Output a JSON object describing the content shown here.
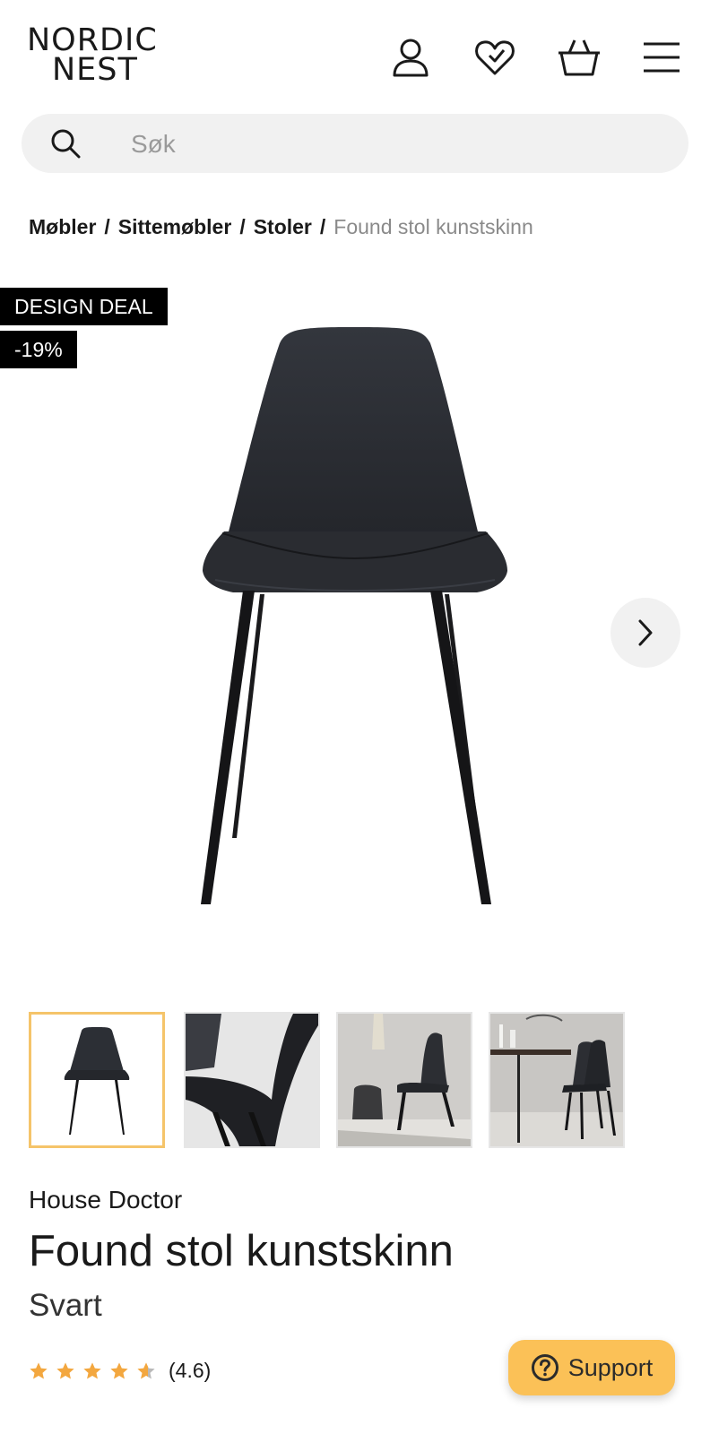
{
  "header": {
    "logo_line1": "NORDIC",
    "logo_line2": "NEST",
    "icons": [
      "user-icon",
      "heart-icon",
      "basket-icon",
      "menu-icon"
    ]
  },
  "search": {
    "placeholder": "Søk",
    "value": ""
  },
  "breadcrumb": {
    "items": [
      "Møbler",
      "Sittemøbler",
      "Stoler"
    ],
    "separator": "/",
    "current": "Found stol kunstskinn"
  },
  "badges": {
    "deal": "DESIGN DEAL",
    "discount": "-19%"
  },
  "gallery": {
    "thumbnails": 4,
    "selected_index": 0
  },
  "product": {
    "brand": "House Doctor",
    "name": "Found stol kunstskinn",
    "variant": "Svart",
    "rating_value": 4.6,
    "rating_label": "(4.6)"
  },
  "support": {
    "label": "Support"
  },
  "colors": {
    "accent": "#fbc157",
    "selected_border": "#f5c46a",
    "badge_bg": "#000000",
    "search_bg": "#f1f1f1",
    "star": "#f3a73f"
  }
}
